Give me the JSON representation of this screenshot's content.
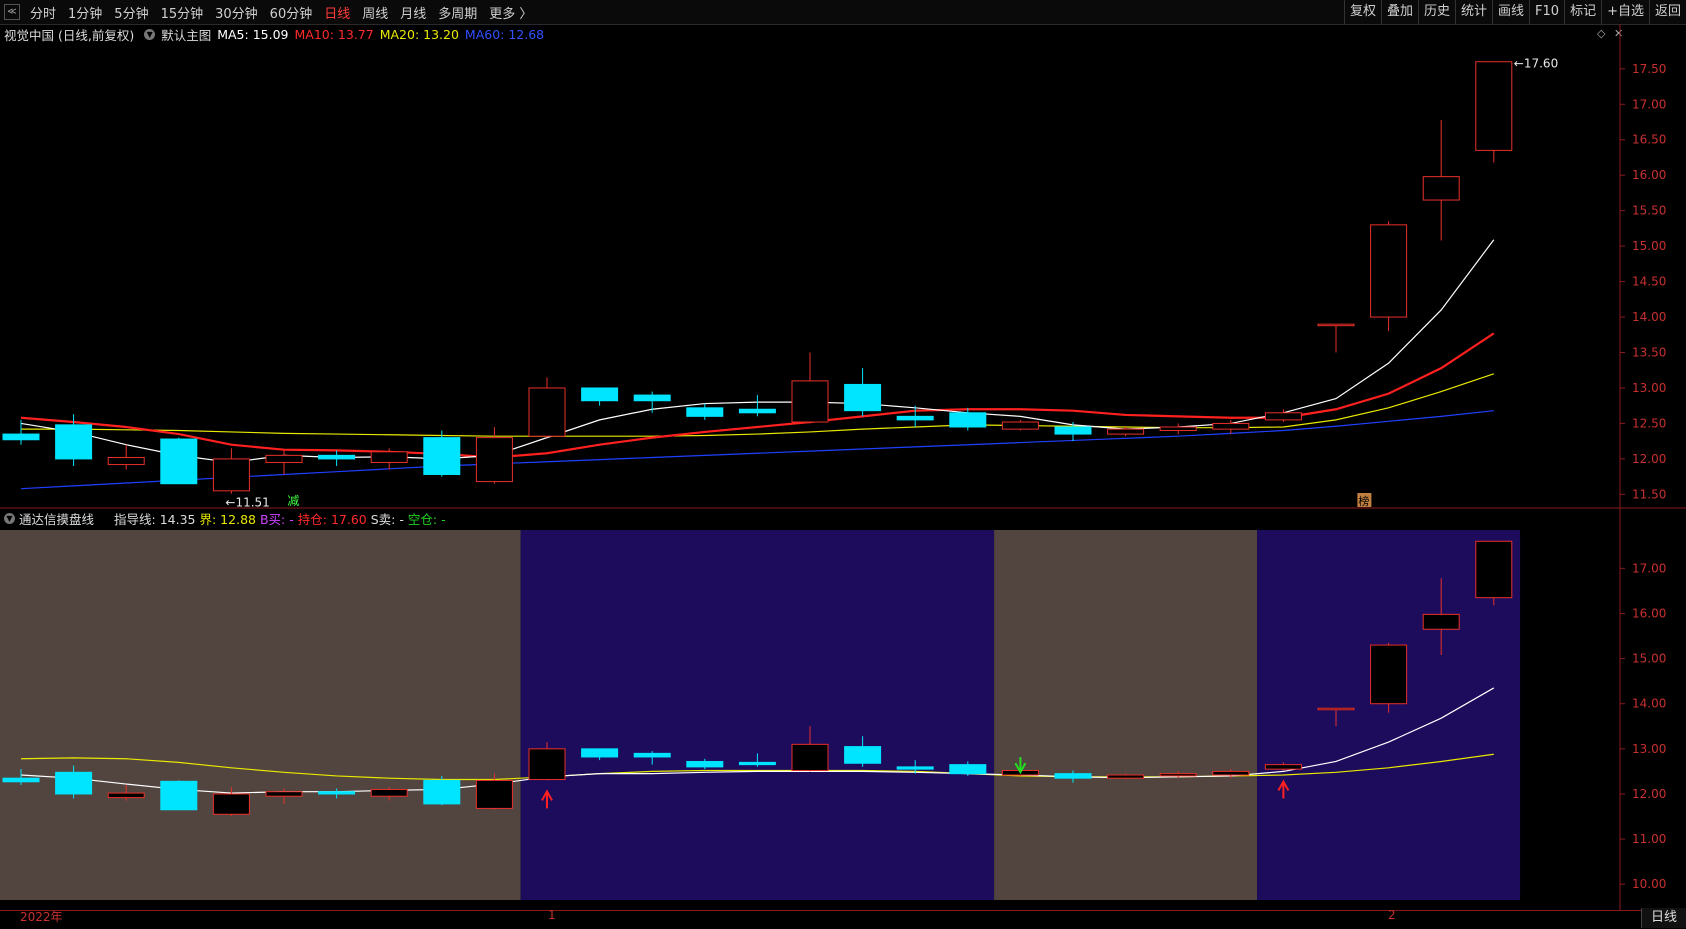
{
  "toolbar": {
    "left_items": [
      "分时",
      "1分钟",
      "5分钟",
      "15分钟",
      "30分钟",
      "60分钟",
      "日线",
      "周线",
      "月线",
      "多周期",
      "更多 〉"
    ],
    "active": "日线",
    "right_items": [
      "复权",
      "叠加",
      "历史",
      "统计",
      "画线",
      "F10",
      "标记",
      "+自选",
      "返回"
    ]
  },
  "main_info": {
    "title": "视觉中国 (日线,前复权)",
    "indicator": "默认主图",
    "ma5": "MA5: 15.09",
    "ma10": "MA10: 13.77",
    "ma20": "MA20: 13.20",
    "ma60": "MA60: 12.68"
  },
  "sub_info": {
    "name": "通达信摸盘线",
    "guide": "指导线: 14.35",
    "boundary": "界: 12.88",
    "buy": "B买: -",
    "hold": "持仓: 17.60",
    "sell": "S卖: -",
    "empty": "空仓: -"
  },
  "colors": {
    "up": "#e8302a",
    "down": "#00e5ff",
    "ma5": "#ffffff",
    "ma10": "#ff2020",
    "ma20": "#e8e800",
    "ma60": "#2040ff",
    "zone_gray": "#52453f",
    "zone_purple": "#1d0b5c"
  },
  "chart_data": {
    "type": "candlestick",
    "main_axis": {
      "ylim": [
        11.35,
        17.85
      ],
      "ticks": [
        "17.50",
        "17.00",
        "16.50",
        "16.00",
        "15.50",
        "15.00",
        "14.50",
        "14.00",
        "13.50",
        "13.00",
        "12.50",
        "12.00",
        "11.50"
      ]
    },
    "sub_axis": {
      "ylim": [
        9.65,
        17.85
      ],
      "ticks": [
        "17.00",
        "16.00",
        "15.00",
        "14.00",
        "13.00",
        "12.00",
        "11.00",
        "10.00"
      ]
    },
    "annotations": {
      "high": "17.60",
      "low": "11.51",
      "mark_left": "减",
      "mark_right": "榜"
    },
    "date_labels": [
      "2022年",
      "1",
      "2"
    ],
    "period_label": "日线",
    "candles": [
      {
        "o": 12.35,
        "h": 12.55,
        "l": 12.2,
        "c": 12.27
      },
      {
        "o": 12.48,
        "h": 12.63,
        "l": 11.9,
        "c": 12.0
      },
      {
        "o": 11.92,
        "h": 12.2,
        "l": 11.85,
        "c": 12.02
      },
      {
        "o": 12.28,
        "h": 12.3,
        "l": 11.65,
        "c": 11.65
      },
      {
        "o": 11.55,
        "h": 12.15,
        "l": 11.51,
        "c": 12.0
      },
      {
        "o": 11.95,
        "h": 12.12,
        "l": 11.78,
        "c": 12.05
      },
      {
        "o": 12.05,
        "h": 12.12,
        "l": 11.9,
        "c": 12.0
      },
      {
        "o": 11.95,
        "h": 12.15,
        "l": 11.85,
        "c": 12.1
      },
      {
        "o": 12.3,
        "h": 12.4,
        "l": 11.75,
        "c": 11.78
      },
      {
        "o": 11.68,
        "h": 12.45,
        "l": 11.65,
        "c": 12.3
      },
      {
        "o": 12.32,
        "h": 13.15,
        "l": 12.3,
        "c": 13.0
      },
      {
        "o": 13.0,
        "h": 13.0,
        "l": 12.75,
        "c": 12.82
      },
      {
        "o": 12.9,
        "h": 12.95,
        "l": 12.65,
        "c": 12.82
      },
      {
        "o": 12.72,
        "h": 12.78,
        "l": 12.55,
        "c": 12.6
      },
      {
        "o": 12.7,
        "h": 12.9,
        "l": 12.6,
        "c": 12.65
      },
      {
        "o": 12.52,
        "h": 13.5,
        "l": 12.5,
        "c": 13.1
      },
      {
        "o": 13.05,
        "h": 13.28,
        "l": 12.6,
        "c": 12.68
      },
      {
        "o": 12.6,
        "h": 12.75,
        "l": 12.45,
        "c": 12.55
      },
      {
        "o": 12.65,
        "h": 12.72,
        "l": 12.4,
        "c": 12.45
      },
      {
        "o": 12.42,
        "h": 12.55,
        "l": 12.4,
        "c": 12.52
      },
      {
        "o": 12.45,
        "h": 12.52,
        "l": 12.25,
        "c": 12.35
      },
      {
        "o": 12.35,
        "h": 12.45,
        "l": 12.32,
        "c": 12.42
      },
      {
        "o": 12.4,
        "h": 12.5,
        "l": 12.35,
        "c": 12.45
      },
      {
        "o": 12.42,
        "h": 12.55,
        "l": 12.35,
        "c": 12.5
      },
      {
        "o": 12.55,
        "h": 12.7,
        "l": 12.52,
        "c": 12.65
      },
      {
        "o": 13.9,
        "h": 13.9,
        "l": 13.5,
        "c": 13.9
      },
      {
        "o": 14.0,
        "h": 15.35,
        "l": 13.8,
        "c": 15.3
      },
      {
        "o": 15.65,
        "h": 16.78,
        "l": 15.08,
        "c": 15.98
      },
      {
        "o": 16.35,
        "h": 17.6,
        "l": 16.18,
        "c": 17.6
      }
    ],
    "ma5": [
      12.5,
      12.38,
      12.2,
      12.05,
      11.95,
      12.05,
      12.02,
      12.03,
      12.0,
      12.05,
      12.3,
      12.55,
      12.7,
      12.78,
      12.8,
      12.8,
      12.78,
      12.72,
      12.65,
      12.6,
      12.48,
      12.42,
      12.45,
      12.5,
      12.65,
      12.85,
      13.35,
      14.1,
      15.09
    ],
    "ma10": [
      12.58,
      12.52,
      12.45,
      12.35,
      12.2,
      12.13,
      12.12,
      12.1,
      12.07,
      12.02,
      12.08,
      12.2,
      12.3,
      12.38,
      12.45,
      12.52,
      12.6,
      12.68,
      12.7,
      12.7,
      12.68,
      12.62,
      12.6,
      12.58,
      12.58,
      12.7,
      12.92,
      13.28,
      13.77
    ],
    "ma20": [
      12.42,
      12.42,
      12.41,
      12.4,
      12.38,
      12.36,
      12.35,
      12.34,
      12.33,
      12.32,
      12.32,
      12.32,
      12.32,
      12.33,
      12.35,
      12.38,
      12.42,
      12.45,
      12.48,
      12.47,
      12.46,
      12.45,
      12.44,
      12.44,
      12.45,
      12.55,
      12.72,
      12.95,
      13.2
    ],
    "ma60": [
      11.58,
      11.62,
      11.66,
      11.7,
      11.74,
      11.78,
      11.82,
      11.86,
      11.9,
      11.93,
      11.96,
      11.99,
      12.02,
      12.05,
      12.08,
      12.11,
      12.14,
      12.17,
      12.2,
      12.23,
      12.26,
      12.29,
      12.32,
      12.36,
      12.4,
      12.46,
      12.53,
      12.6,
      12.68
    ],
    "sub_guide": [
      12.42,
      12.35,
      12.22,
      12.1,
      12.02,
      12.05,
      12.05,
      12.08,
      12.1,
      12.22,
      12.38,
      12.45,
      12.45,
      12.48,
      12.5,
      12.5,
      12.5,
      12.48,
      12.45,
      12.42,
      12.38,
      12.36,
      12.38,
      12.4,
      12.5,
      12.72,
      13.15,
      13.68,
      14.35
    ],
    "sub_boundary": [
      12.78,
      12.8,
      12.78,
      12.7,
      12.58,
      12.48,
      12.4,
      12.35,
      12.32,
      12.32,
      12.38,
      12.45,
      12.5,
      12.52,
      12.52,
      12.52,
      12.52,
      12.5,
      12.45,
      12.4,
      12.38,
      12.38,
      12.38,
      12.4,
      12.42,
      12.48,
      12.58,
      12.72,
      12.88
    ],
    "zones": [
      {
        "from": 0,
        "to": 9,
        "type": "gray"
      },
      {
        "from": 10,
        "to": 18,
        "type": "purple"
      },
      {
        "from": 19,
        "to": 23,
        "type": "gray"
      },
      {
        "from": 24,
        "to": 28,
        "type": "purple"
      }
    ],
    "signals": [
      {
        "index": 10,
        "type": "buy"
      },
      {
        "index": 19,
        "type": "sell"
      },
      {
        "index": 24,
        "type": "buy"
      }
    ]
  }
}
